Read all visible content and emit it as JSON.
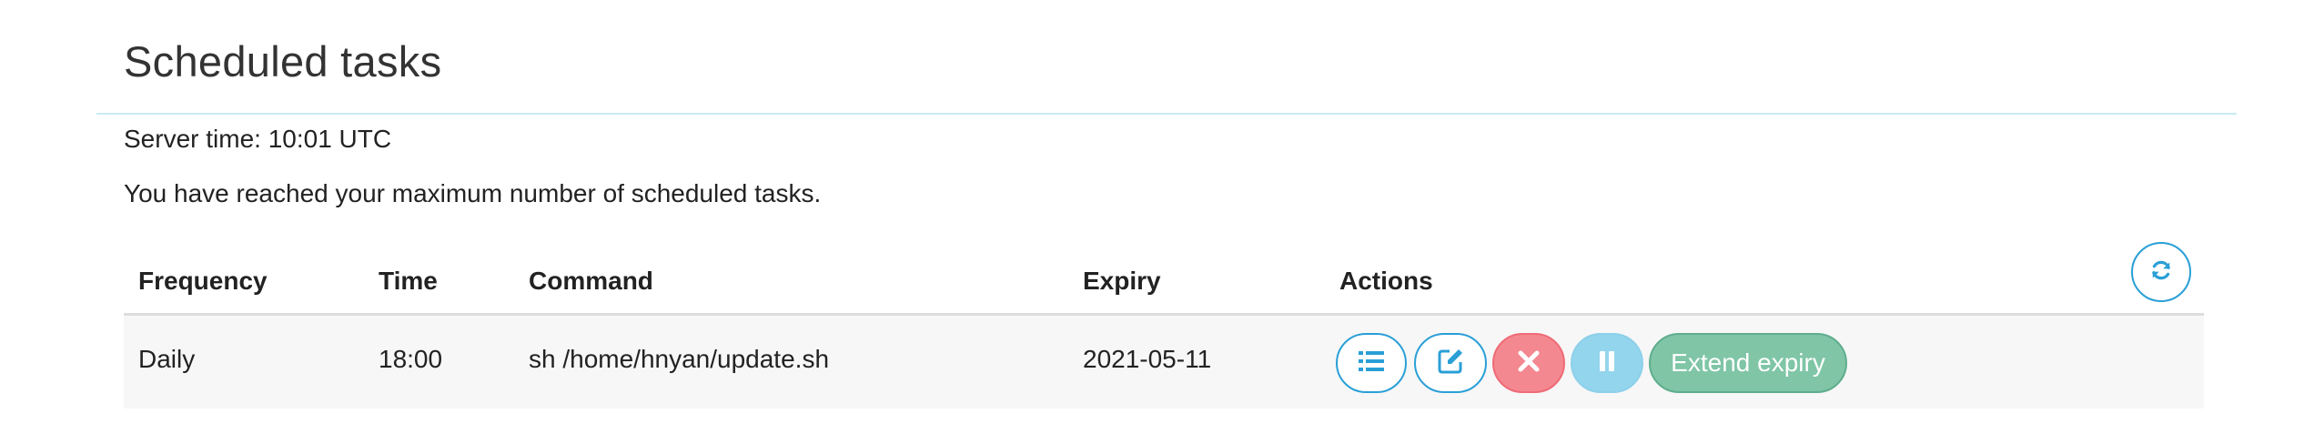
{
  "header": {
    "title": "Scheduled tasks"
  },
  "info": {
    "server_time": "Server time: 10:01 UTC",
    "limit_message": "You have reached your maximum number of scheduled tasks."
  },
  "table": {
    "columns": [
      "Frequency",
      "Time",
      "Command",
      "Expiry",
      "Actions"
    ],
    "rows": [
      {
        "frequency": "Daily",
        "time": "18:00",
        "command": "sh /home/hnyan/update.sh",
        "expiry": "2021-05-11",
        "extend_label": "Extend expiry"
      }
    ]
  },
  "icons": {
    "refresh": "refresh-icon",
    "list": "list-icon",
    "edit": "edit-icon",
    "delete": "close-icon",
    "pause": "pause-icon"
  },
  "colors": {
    "accent": "#2a9fd6",
    "danger": "#f48891",
    "info": "#93d5ec",
    "success": "#7fc5a6",
    "rule": "#c9ebf4"
  }
}
